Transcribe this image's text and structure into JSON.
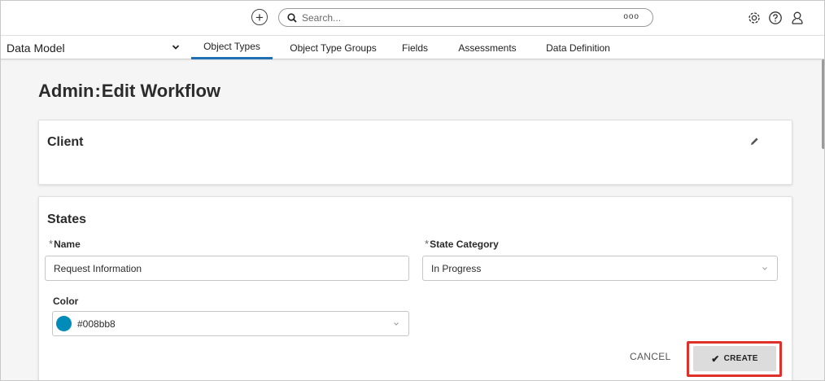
{
  "topbar": {
    "add_icon": "plus-circle-icon",
    "search": {
      "placeholder": "Search...",
      "options_glyph": "ooo"
    },
    "icons": [
      "gear-icon",
      "help-icon",
      "user-icon"
    ]
  },
  "navbar": {
    "module_select": "Data Model",
    "tabs": [
      {
        "label": "Object Types",
        "active": true
      },
      {
        "label": "Object Type Groups",
        "active": false
      },
      {
        "label": "Fields",
        "active": false
      },
      {
        "label": "Assessments",
        "active": false
      },
      {
        "label": "Data Definition",
        "active": false
      }
    ]
  },
  "page": {
    "title_prefix": "Admin",
    "title_sep": ":",
    "title": "Edit Workflow"
  },
  "client_card": {
    "title": "Client"
  },
  "states_card": {
    "title": "States",
    "name": {
      "label": "Name",
      "required_mark": "*",
      "value": "Request Information"
    },
    "state_category": {
      "label": "State Category",
      "required_mark": "*",
      "value": "In Progress"
    },
    "color": {
      "label": "Color",
      "value": "#008bb8",
      "swatch_color": "#008bb8"
    },
    "cancel_label": "CANCEL",
    "create_label": "CREATE"
  },
  "colors": {
    "accent": "#1f6fb3",
    "highlight": "#e0302a",
    "create_bg": "#dcdcdc"
  }
}
